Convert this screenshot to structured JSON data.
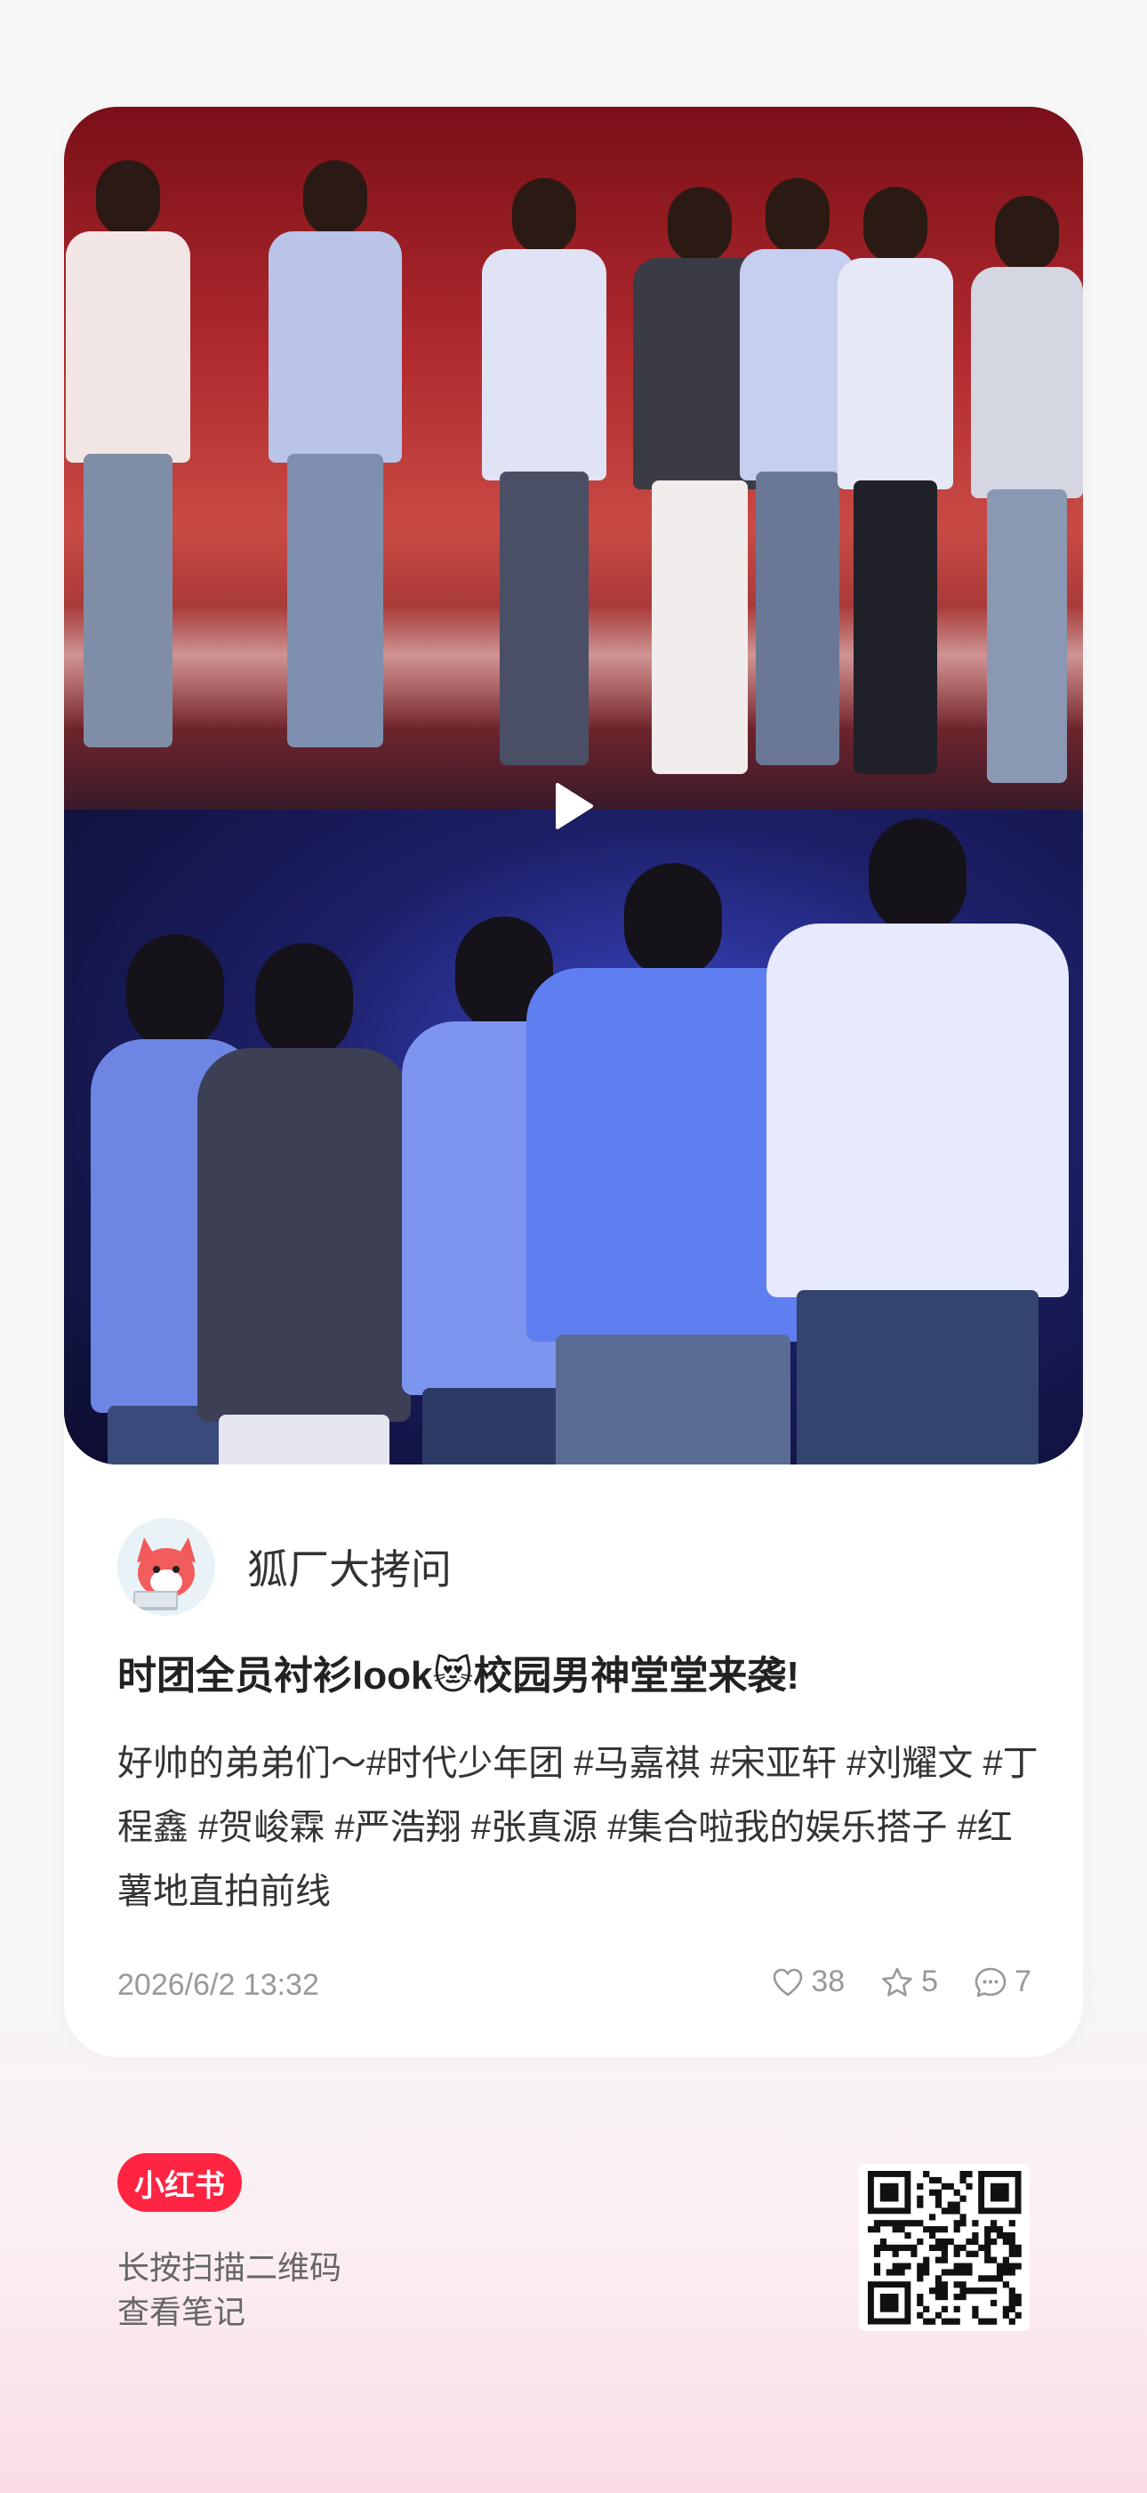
{
  "post": {
    "author": "狐厂大拷问",
    "title": "时团全员衬衫look😻校园男神堂堂来袭!",
    "description": "好帅的弟弟们～#时代少年团  #马嘉祺  #宋亚轩  #刘耀文  #丁程鑫  #贺峻霖  #严浩翔  #张真源  #集合啦我的娱乐搭子  #红薯地直拍前线",
    "date": "2026/6/2 13:32",
    "likes": "38",
    "collects": "5",
    "comments": "7"
  },
  "footer": {
    "logo_text": "小红书",
    "hint_line1": "长按扫描二维码",
    "hint_line2": "查看笔记"
  },
  "colors": {
    "brand": "#ff2442",
    "muted": "#999999"
  },
  "icons": {
    "play": "play-icon",
    "like": "heart-icon",
    "collect": "star-icon",
    "comment": "comment-icon"
  }
}
